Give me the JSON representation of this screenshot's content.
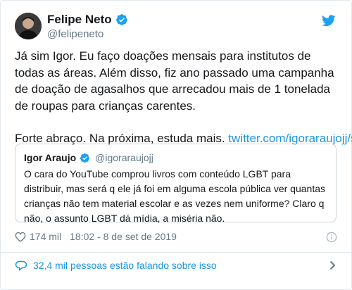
{
  "author": {
    "name": "Felipe Neto",
    "handle": "@felipeneto"
  },
  "tweet": {
    "paragraph1": "Já sim Igor. Eu faço doações mensais para institutos de todas as áreas. Além disso, fiz ano passado uma campanha de doação de agasalhos que arrecadou mais de 1 tonelada de roupas para crianças carentes.",
    "paragraph2": "Forte abraço. Na próxima, estuda mais. ",
    "link": "twitter.com/igoraraujojj/s…"
  },
  "quoted": {
    "name": "Igor Araujo",
    "handle": "@igoraraujojj",
    "text": "O cara do YouTube comprou livros com conteúdo LGBT para distribuir, mas será q ele já foi em alguma escola pública ver quantas crianças não tem material escolar e as vezes nem uniforme? Claro q não, o assunto LGBT dá mídia, a miséria não."
  },
  "meta": {
    "likes": "174 mil",
    "timestamp": "18:02 - 8 de set de 2019"
  },
  "conversation": {
    "text": "32,4 mil pessoas estão falando sobre isso"
  },
  "colors": {
    "accent": "#1b95e0",
    "verified": "#1da1f2",
    "secondary_text": "#657786",
    "border": "#e1e8ed"
  }
}
